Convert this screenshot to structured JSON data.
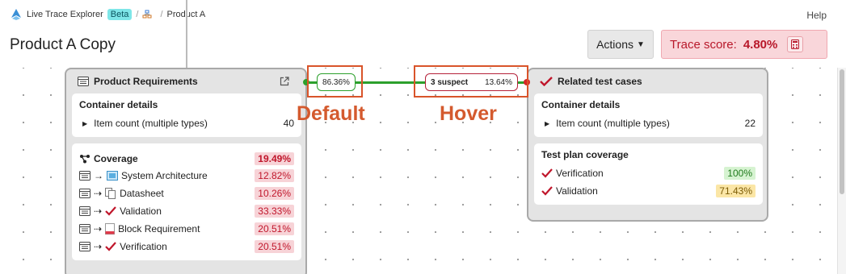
{
  "app": {
    "name": "Live Trace Explorer",
    "badge": "Beta",
    "breadcrumb_item": "Product A",
    "help": "Help"
  },
  "page": {
    "title": "Product A Copy"
  },
  "actions": {
    "label": "Actions"
  },
  "trace_score": {
    "label": "Trace score:",
    "value": "4.80%"
  },
  "left_node": {
    "title": "Product Requirements",
    "container_details": {
      "title": "Container details",
      "item_count_label": "Item count (multiple types)",
      "item_count": "40"
    },
    "coverage": {
      "title": "Coverage",
      "total": "19.49%",
      "rows": [
        {
          "label": "System Architecture",
          "value": "12.82%",
          "icon": "architecture-icon"
        },
        {
          "label": "Datasheet",
          "value": "10.26%",
          "icon": "datasheet-icon"
        },
        {
          "label": "Validation",
          "value": "33.33%",
          "icon": "checkmark-icon"
        },
        {
          "label": "Block Requirement",
          "value": "20.51%",
          "icon": "block-requirement-icon"
        },
        {
          "label": "Verification",
          "value": "20.51%",
          "icon": "checkmark-icon"
        }
      ]
    }
  },
  "right_node": {
    "title": "Related test cases",
    "container_details": {
      "title": "Container details",
      "item_count_label": "Item count (multiple types)",
      "item_count": "22"
    },
    "test_plan": {
      "title": "Test plan coverage",
      "rows": [
        {
          "label": "Verification",
          "value": "100%"
        },
        {
          "label": "Validation",
          "value": "71.43%"
        }
      ]
    }
  },
  "edge": {
    "default_pct": "86.36%",
    "hover_suspect": "3 suspect",
    "hover_pct": "13.64%"
  },
  "annotations": {
    "default": "Default",
    "hover": "Hover"
  },
  "colors": {
    "accent_red": "#c0162b",
    "edge_green": "#2ca02c",
    "annotation": "#d45a2e"
  }
}
